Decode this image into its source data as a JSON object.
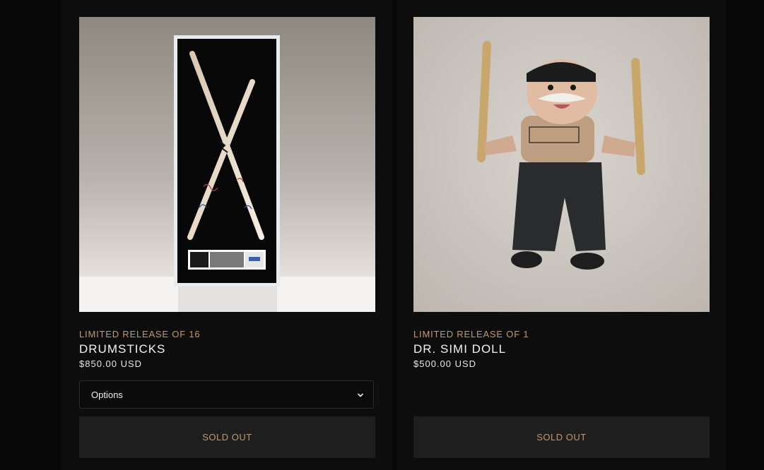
{
  "products": [
    {
      "release": "LIMITED RELEASE OF 16",
      "title": "DRUMSTICKS",
      "price": "$850.00 USD",
      "options_label": "Options",
      "button_label": "SOLD OUT",
      "image_icon": "drumsticks-frame-photo"
    },
    {
      "release": "LIMITED RELEASE OF 1",
      "title": "DR. SIMI DOLL",
      "price": "$500.00 USD",
      "button_label": "SOLD OUT",
      "image_icon": "dr-simi-doll-photo"
    }
  ],
  "colors": {
    "accent": "#c29a6a",
    "background": "#070707",
    "card_panel": "#0d0d0d",
    "button_bg": "#1e1e1e"
  }
}
